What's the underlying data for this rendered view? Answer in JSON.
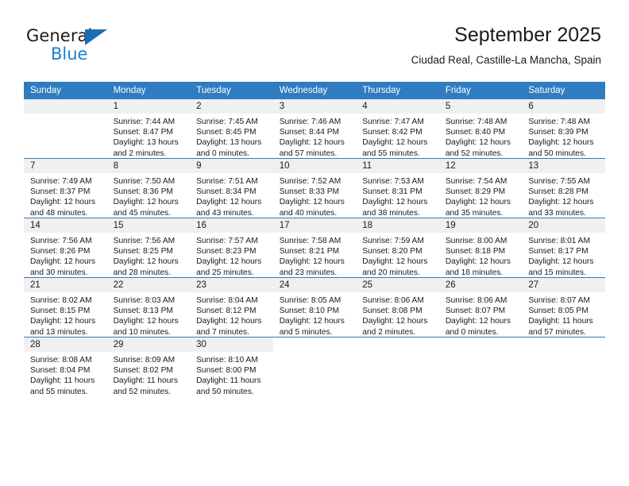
{
  "logo": {
    "word1": "General",
    "word2": "Blue",
    "triangle_color": "#1c6cb0",
    "blue_text_color": "#1c7fd4"
  },
  "header": {
    "title": "September 2025",
    "subtitle": "Ciudad Real, Castille-La Mancha, Spain"
  },
  "theme": {
    "header_blue": "#2f7cc0",
    "day_band_gray": "#f0f0f0",
    "text_color": "#1a1a1a"
  },
  "weekday_headers": [
    "Sunday",
    "Monday",
    "Tuesday",
    "Wednesday",
    "Thursday",
    "Friday",
    "Saturday"
  ],
  "weeks": [
    [
      {
        "day": "",
        "lines": []
      },
      {
        "day": "1",
        "lines": [
          "Sunrise: 7:44 AM",
          "Sunset: 8:47 PM",
          "Daylight: 13 hours",
          "and 2 minutes."
        ]
      },
      {
        "day": "2",
        "lines": [
          "Sunrise: 7:45 AM",
          "Sunset: 8:45 PM",
          "Daylight: 13 hours",
          "and 0 minutes."
        ]
      },
      {
        "day": "3",
        "lines": [
          "Sunrise: 7:46 AM",
          "Sunset: 8:44 PM",
          "Daylight: 12 hours",
          "and 57 minutes."
        ]
      },
      {
        "day": "4",
        "lines": [
          "Sunrise: 7:47 AM",
          "Sunset: 8:42 PM",
          "Daylight: 12 hours",
          "and 55 minutes."
        ]
      },
      {
        "day": "5",
        "lines": [
          "Sunrise: 7:48 AM",
          "Sunset: 8:40 PM",
          "Daylight: 12 hours",
          "and 52 minutes."
        ]
      },
      {
        "day": "6",
        "lines": [
          "Sunrise: 7:48 AM",
          "Sunset: 8:39 PM",
          "Daylight: 12 hours",
          "and 50 minutes."
        ]
      }
    ],
    [
      {
        "day": "7",
        "lines": [
          "Sunrise: 7:49 AM",
          "Sunset: 8:37 PM",
          "Daylight: 12 hours",
          "and 48 minutes."
        ]
      },
      {
        "day": "8",
        "lines": [
          "Sunrise: 7:50 AM",
          "Sunset: 8:36 PM",
          "Daylight: 12 hours",
          "and 45 minutes."
        ]
      },
      {
        "day": "9",
        "lines": [
          "Sunrise: 7:51 AM",
          "Sunset: 8:34 PM",
          "Daylight: 12 hours",
          "and 43 minutes."
        ]
      },
      {
        "day": "10",
        "lines": [
          "Sunrise: 7:52 AM",
          "Sunset: 8:33 PM",
          "Daylight: 12 hours",
          "and 40 minutes."
        ]
      },
      {
        "day": "11",
        "lines": [
          "Sunrise: 7:53 AM",
          "Sunset: 8:31 PM",
          "Daylight: 12 hours",
          "and 38 minutes."
        ]
      },
      {
        "day": "12",
        "lines": [
          "Sunrise: 7:54 AM",
          "Sunset: 8:29 PM",
          "Daylight: 12 hours",
          "and 35 minutes."
        ]
      },
      {
        "day": "13",
        "lines": [
          "Sunrise: 7:55 AM",
          "Sunset: 8:28 PM",
          "Daylight: 12 hours",
          "and 33 minutes."
        ]
      }
    ],
    [
      {
        "day": "14",
        "lines": [
          "Sunrise: 7:56 AM",
          "Sunset: 8:26 PM",
          "Daylight: 12 hours",
          "and 30 minutes."
        ]
      },
      {
        "day": "15",
        "lines": [
          "Sunrise: 7:56 AM",
          "Sunset: 8:25 PM",
          "Daylight: 12 hours",
          "and 28 minutes."
        ]
      },
      {
        "day": "16",
        "lines": [
          "Sunrise: 7:57 AM",
          "Sunset: 8:23 PM",
          "Daylight: 12 hours",
          "and 25 minutes."
        ]
      },
      {
        "day": "17",
        "lines": [
          "Sunrise: 7:58 AM",
          "Sunset: 8:21 PM",
          "Daylight: 12 hours",
          "and 23 minutes."
        ]
      },
      {
        "day": "18",
        "lines": [
          "Sunrise: 7:59 AM",
          "Sunset: 8:20 PM",
          "Daylight: 12 hours",
          "and 20 minutes."
        ]
      },
      {
        "day": "19",
        "lines": [
          "Sunrise: 8:00 AM",
          "Sunset: 8:18 PM",
          "Daylight: 12 hours",
          "and 18 minutes."
        ]
      },
      {
        "day": "20",
        "lines": [
          "Sunrise: 8:01 AM",
          "Sunset: 8:17 PM",
          "Daylight: 12 hours",
          "and 15 minutes."
        ]
      }
    ],
    [
      {
        "day": "21",
        "lines": [
          "Sunrise: 8:02 AM",
          "Sunset: 8:15 PM",
          "Daylight: 12 hours",
          "and 13 minutes."
        ]
      },
      {
        "day": "22",
        "lines": [
          "Sunrise: 8:03 AM",
          "Sunset: 8:13 PM",
          "Daylight: 12 hours",
          "and 10 minutes."
        ]
      },
      {
        "day": "23",
        "lines": [
          "Sunrise: 8:04 AM",
          "Sunset: 8:12 PM",
          "Daylight: 12 hours",
          "and 7 minutes."
        ]
      },
      {
        "day": "24",
        "lines": [
          "Sunrise: 8:05 AM",
          "Sunset: 8:10 PM",
          "Daylight: 12 hours",
          "and 5 minutes."
        ]
      },
      {
        "day": "25",
        "lines": [
          "Sunrise: 8:06 AM",
          "Sunset: 8:08 PM",
          "Daylight: 12 hours",
          "and 2 minutes."
        ]
      },
      {
        "day": "26",
        "lines": [
          "Sunrise: 8:06 AM",
          "Sunset: 8:07 PM",
          "Daylight: 12 hours",
          "and 0 minutes."
        ]
      },
      {
        "day": "27",
        "lines": [
          "Sunrise: 8:07 AM",
          "Sunset: 8:05 PM",
          "Daylight: 11 hours",
          "and 57 minutes."
        ]
      }
    ],
    [
      {
        "day": "28",
        "lines": [
          "Sunrise: 8:08 AM",
          "Sunset: 8:04 PM",
          "Daylight: 11 hours",
          "and 55 minutes."
        ]
      },
      {
        "day": "29",
        "lines": [
          "Sunrise: 8:09 AM",
          "Sunset: 8:02 PM",
          "Daylight: 11 hours",
          "and 52 minutes."
        ]
      },
      {
        "day": "30",
        "lines": [
          "Sunrise: 8:10 AM",
          "Sunset: 8:00 PM",
          "Daylight: 11 hours",
          "and 50 minutes."
        ]
      },
      {
        "day": "",
        "lines": []
      },
      {
        "day": "",
        "lines": []
      },
      {
        "day": "",
        "lines": []
      },
      {
        "day": "",
        "lines": []
      }
    ]
  ]
}
